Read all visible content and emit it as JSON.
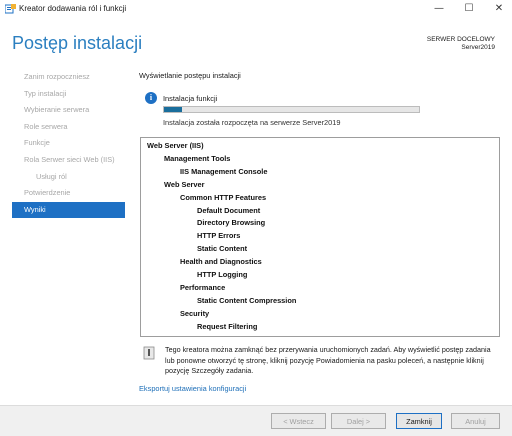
{
  "window": {
    "title": "Kreator dodawania ról i funkcji",
    "minimize": "—",
    "maximize": "☐",
    "close": "✕"
  },
  "header": {
    "title": "Postęp instalacji",
    "server_label": "SERWER DOCELOWY",
    "server_name": "Server2019"
  },
  "nav": {
    "items": [
      {
        "label": "Zanim rozpoczniesz",
        "state": "disabled"
      },
      {
        "label": "Typ instalacji",
        "state": "disabled"
      },
      {
        "label": "Wybieranie serwera",
        "state": "disabled"
      },
      {
        "label": "Role serwera",
        "state": "disabled"
      },
      {
        "label": "Funkcje",
        "state": "disabled"
      },
      {
        "label": "Rola Serwer sieci Web (IIS)",
        "state": "disabled"
      },
      {
        "label": "Usługi ról",
        "state": "disabled"
      },
      {
        "label": "Potwierdzenie",
        "state": "disabled"
      },
      {
        "label": "Wyniki",
        "state": "active"
      }
    ]
  },
  "main": {
    "section_title": "Wyświetlanie postępu instalacji",
    "feature_label": "Instalacja funkcji",
    "progress_fraction": 0.07,
    "progress_status": "Instalacja została rozpoczęta na serwerze Server2019"
  },
  "results": {
    "lines": [
      {
        "text": "Web Server (IIS)",
        "level": 0
      },
      {
        "text": "Management Tools",
        "level": 1
      },
      {
        "text": "IIS Management Console",
        "level": 2
      },
      {
        "text": "Web Server",
        "level": 1
      },
      {
        "text": "Common HTTP Features",
        "level": 2
      },
      {
        "text": "Default Document",
        "level": 3
      },
      {
        "text": "Directory Browsing",
        "level": 3
      },
      {
        "text": "HTTP Errors",
        "level": 3
      },
      {
        "text": "Static Content",
        "level": 3
      },
      {
        "text": "Health and Diagnostics",
        "level": 2
      },
      {
        "text": "HTTP Logging",
        "level": 3
      },
      {
        "text": "Performance",
        "level": 2
      },
      {
        "text": "Static Content Compression",
        "level": 3
      },
      {
        "text": "Security",
        "level": 2
      },
      {
        "text": "Request Filtering",
        "level": 3
      }
    ]
  },
  "note": {
    "text": "Tego kreatora można zamknąć bez przerywania uruchomionych zadań. Aby wyświetlić postęp zadania lub ponowne otworzyć tę stronę, kliknij pozycję Powiadomienia na pasku poleceń, a następnie kliknij pozycję Szczegóły zadania."
  },
  "export_link": "Eksportuj ustawienia konfiguracji",
  "footer": {
    "back": "< Wstecz",
    "next": "Dalej >",
    "close": "Zamknij",
    "cancel": "Anuluj"
  },
  "colors": {
    "accent": "#1e70c4",
    "title": "#2b7fc0",
    "progress": "#1a6e9c"
  }
}
